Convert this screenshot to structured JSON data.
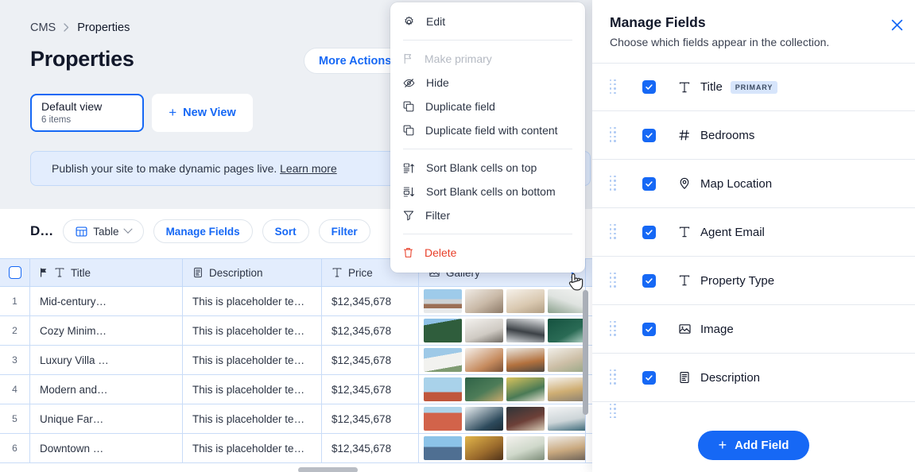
{
  "breadcrumb": {
    "root": "CMS",
    "separator": "›",
    "current": "Properties"
  },
  "page": {
    "title": "Properties"
  },
  "header_actions": {
    "more_actions": "More Actions"
  },
  "views": {
    "default": {
      "name": "Default view",
      "count": "6 items"
    },
    "new_view": {
      "label": "New View",
      "plus": "+"
    }
  },
  "banner": {
    "text": "Publish your site to make dynamic pages live.",
    "link": "Learn more"
  },
  "toolbar": {
    "view_name_truncated": "D…",
    "table_label": "Table",
    "manage_fields": "Manage Fields",
    "sort": "Sort",
    "filter": "Filter"
  },
  "table": {
    "columns": [
      {
        "key": "index",
        "label": "",
        "icon": ""
      },
      {
        "key": "title",
        "label": "Title",
        "icon": "text-icon",
        "primary_flag": true
      },
      {
        "key": "description",
        "label": "Description",
        "icon": "richtext-icon"
      },
      {
        "key": "price",
        "label": "Price",
        "icon": "text-icon"
      },
      {
        "key": "gallery",
        "label": "Gallery",
        "icon": "image-icon",
        "has_menu": true
      }
    ],
    "rows": [
      {
        "index": "1",
        "title": "Mid-century…",
        "description": "This is placeholder te…",
        "price": "$12,345,678",
        "gallery_count": 4
      },
      {
        "index": "2",
        "title": "Cozy Minim…",
        "description": "This is placeholder te…",
        "price": "$12,345,678",
        "gallery_count": 4
      },
      {
        "index": "3",
        "title": "Luxury Villa …",
        "description": "This is placeholder te…",
        "price": "$12,345,678",
        "gallery_count": 4
      },
      {
        "index": "4",
        "title": "Modern and…",
        "description": "This is placeholder te…",
        "price": "$12,345,678",
        "gallery_count": 4
      },
      {
        "index": "5",
        "title": "Unique Far…",
        "description": "This is placeholder te…",
        "price": "$12,345,678",
        "gallery_count": 4
      },
      {
        "index": "6",
        "title": "Downtown …",
        "description": "This is placeholder te…",
        "price": "$12,345,678",
        "gallery_count": 4
      }
    ]
  },
  "context_menu": {
    "items": [
      {
        "label": "Edit",
        "icon": "gear-icon",
        "state": "enabled"
      },
      {
        "divider": true
      },
      {
        "label": "Make primary",
        "icon": "flag-icon",
        "state": "disabled"
      },
      {
        "label": "Hide",
        "icon": "eye-off-icon",
        "state": "enabled"
      },
      {
        "label": "Duplicate field",
        "icon": "copy-icon",
        "state": "enabled"
      },
      {
        "label": "Duplicate field with content",
        "icon": "copy-icon",
        "state": "enabled"
      },
      {
        "divider": true
      },
      {
        "label": "Sort Blank cells on top",
        "icon": "sort-asc-icon",
        "state": "enabled"
      },
      {
        "label": "Sort Blank cells on bottom",
        "icon": "sort-desc-icon",
        "state": "enabled"
      },
      {
        "label": "Filter",
        "icon": "filter-icon",
        "state": "enabled"
      },
      {
        "divider": true
      },
      {
        "label": "Delete",
        "icon": "trash-icon",
        "state": "danger"
      }
    ]
  },
  "panel": {
    "title": "Manage Fields",
    "subtitle": "Choose which fields appear in the collection.",
    "close_label": "×",
    "fields": [
      {
        "name": "Title",
        "icon": "text-icon",
        "checked": true,
        "badge": "PRIMARY"
      },
      {
        "name": "Bedrooms",
        "icon": "number-icon",
        "checked": true,
        "badge": ""
      },
      {
        "name": "Map Location",
        "icon": "map-pin-icon",
        "checked": true,
        "badge": ""
      },
      {
        "name": "Agent Email",
        "icon": "text-icon",
        "checked": true,
        "badge": ""
      },
      {
        "name": "Property Type",
        "icon": "text-icon",
        "checked": true,
        "badge": ""
      },
      {
        "name": "Image",
        "icon": "image-icon",
        "checked": true,
        "badge": ""
      },
      {
        "name": "Description",
        "icon": "richtext-icon",
        "checked": true,
        "badge": ""
      }
    ],
    "add_field": {
      "label": "Add Field",
      "plus": "+"
    }
  },
  "colors": {
    "accent": "#1668f5",
    "danger": "#e8402a",
    "page_bg": "#edf0f4",
    "banner_bg": "#e3edfd",
    "header_bg": "#e3edfd",
    "grid_line": "#c9dcf7"
  }
}
